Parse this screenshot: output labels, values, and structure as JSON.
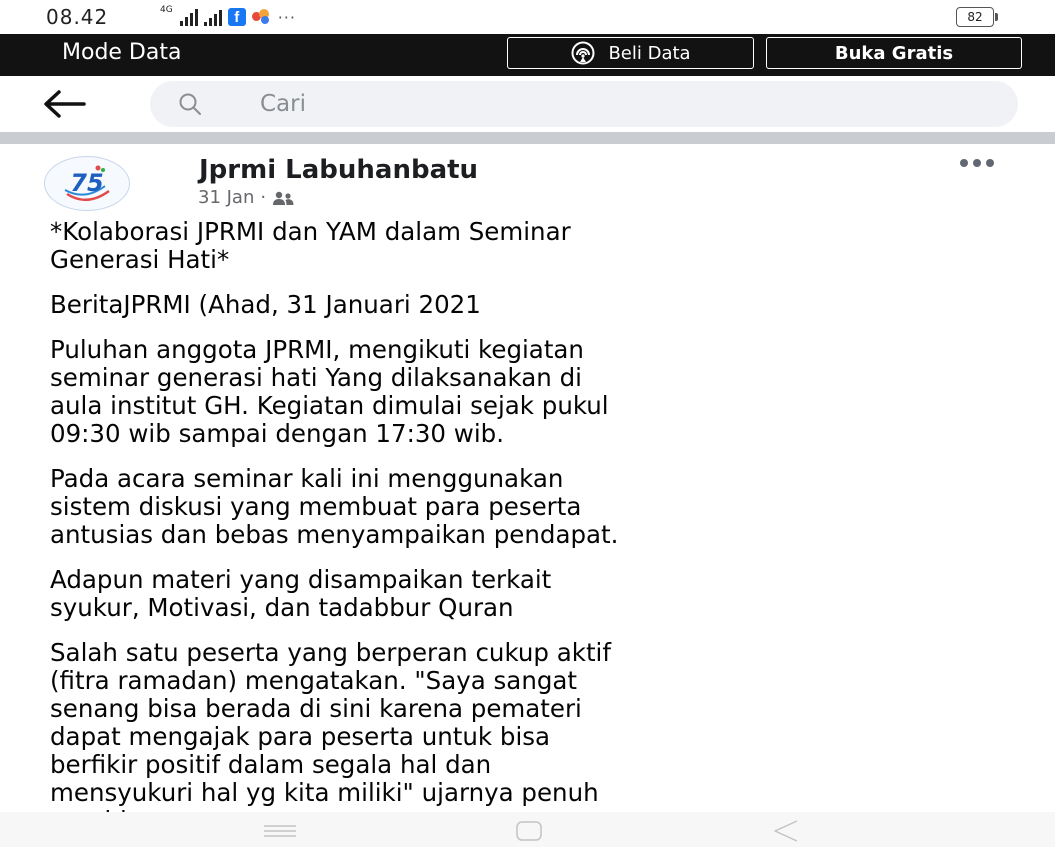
{
  "status_bar": {
    "time": "08.42",
    "network_tag": "4G",
    "facebook_glyph": "f",
    "more": "···",
    "battery": "82"
  },
  "mode_bar": {
    "title": "Mode Data",
    "beli_label": "Beli Data",
    "buka_label": "Buka Gratis",
    "background": "#121212"
  },
  "search": {
    "placeholder": "Cari"
  },
  "post": {
    "author": "Jprmi Labuhanbatu",
    "date": "31 Jan",
    "separator": "·",
    "avatar_text": "75",
    "paragraphs": [
      "*Kolaborasi JPRMI dan YAM dalam Seminar\nGenerasi Hati*",
      "BeritaJPRMI (Ahad, 31 Januari 2021",
      "Puluhan anggota JPRMI, mengikuti kegiatan\nseminar generasi hati Yang dilaksanakan di\naula institut GH. Kegiatan dimulai sejak pukul\n09:30 wib sampai dengan 17:30 wib.",
      "Pada acara seminar kali ini menggunakan\nsistem diskusi yang membuat para peserta\nantusias dan bebas menyampaikan pendapat.",
      "Adapun materi yang disampaikan terkait\nsyukur, Motivasi, dan tadabbur Quran",
      "Salah satu peserta yang berperan cukup aktif\n(fitra ramadan) mengatakan. \"Saya sangat\nsenang bisa berada di sini karena pemateri\ndapat mengajak para peserta untuk bisa\nberfikir positif dalam segala hal dan\nmensyukuri hal yg kita miliki\" ujarnya penuh\ngembira."
    ]
  },
  "icons": {
    "back": "arrow-left-icon",
    "search": "search-icon",
    "hotspot": "hotspot-icon",
    "friends": "friends-icon",
    "more": "more-horizontal-icon",
    "nav_menu": "menu-icon",
    "nav_home": "home-square-icon",
    "nav_back": "back-triangle-icon"
  },
  "colors": {
    "accent": "#1877f2",
    "meta_text": "#65676b",
    "search_bg": "#f0f2f5"
  }
}
